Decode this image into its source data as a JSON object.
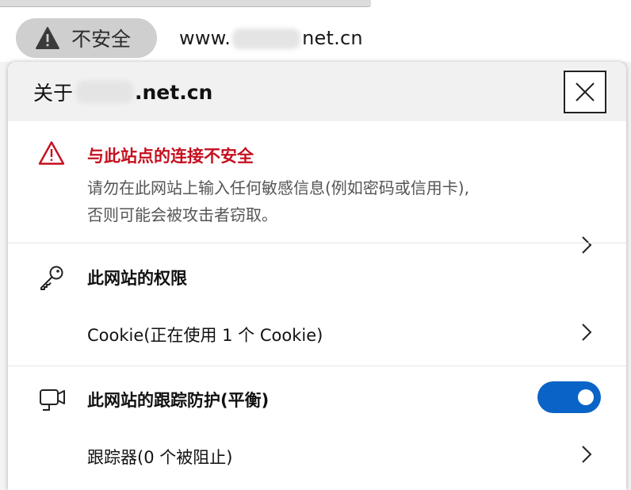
{
  "address_bar": {
    "security_label": "不安全",
    "url_prefix": "www.",
    "url_suffix": "net.cn"
  },
  "panel": {
    "title_prefix": "关于",
    "title_domain": ".net.cn",
    "warning": {
      "heading": "与此站点的连接不安全",
      "line1": "请勿在此网站上输入任何敏感信息(例如密码或信用卡),",
      "line2": "否则可能会被攻击者窃取。"
    },
    "permissions": {
      "heading": "此网站的权限",
      "cookie_item": "Cookie(正在使用 1 个 Cookie)"
    },
    "tracking": {
      "heading": "此网站的跟踪防护(平衡)",
      "toggle_on": true,
      "trackers_item": "跟踪器(0 个被阻止)"
    }
  },
  "colors": {
    "warning_red": "#c50f1f",
    "toggle_blue": "#0a63c6",
    "chip_gray": "#cfcfcf"
  }
}
